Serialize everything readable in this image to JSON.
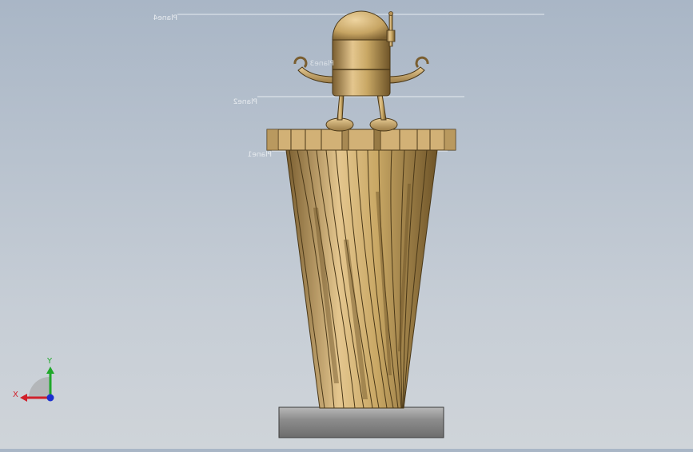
{
  "viewport": {
    "plane_labels": {
      "plane4": "Plane4",
      "plane3": "Plane3",
      "plane2": "Plane2",
      "plane1": "Plane1"
    }
  },
  "triad": {
    "x_label": "X",
    "y_label": "Y",
    "colors": {
      "x": "#d0202a",
      "y": "#1fa82a",
      "z": "#1c2fd0"
    }
  },
  "colors": {
    "gold": "#c8a86a",
    "gold_dark": "#8a6d3a",
    "gold_light": "#e2c48c",
    "base": "#9a9a9a"
  }
}
